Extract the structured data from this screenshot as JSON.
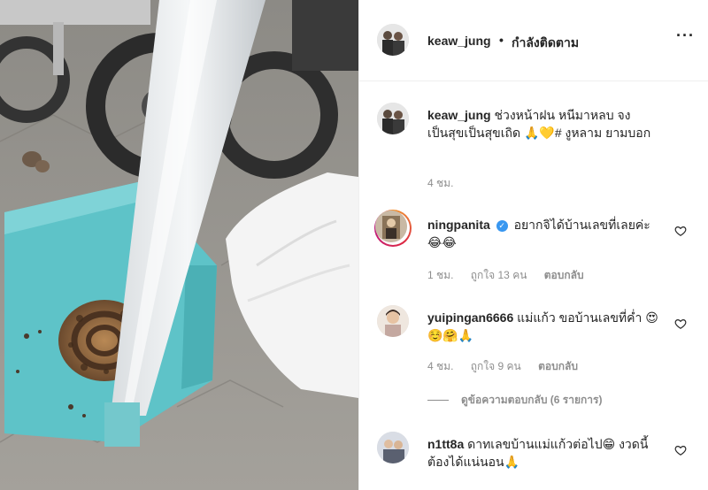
{
  "post": {
    "username": "keaw_jung",
    "separator": "•",
    "follow_status": "กำลังติดตาม",
    "more_label": "···",
    "caption": "ช่วงหน้าฝน หนีมาหลบ จงเป็นสุขเป็นสุขเถิด 🙏💛# งูหลาม ยามบอก",
    "time": "4 ชม."
  },
  "comments": [
    {
      "username": "ningpanita",
      "verified": true,
      "text": "อยากจิได้บ้านเลขที่เลยค่ะ 😂😂",
      "time": "1 ชม.",
      "likes": "ถูกใจ 13 คน",
      "reply": "ตอบกลับ"
    },
    {
      "username": "yuipingan6666",
      "verified": false,
      "text": "แม่แก้ว ขอบ้านเลขที่ค่ำ 😍☺️🤗🙏",
      "time": "4 ชม.",
      "likes": "ถูกใจ 9 คน",
      "reply": "ตอบกลับ"
    },
    {
      "username": "n1tt8a",
      "verified": false,
      "text": "ดาทเลขบ้านแม่แก้วต่อไป😁 งวดนี้ต้องได้แน่นอน🙏"
    }
  ],
  "view_replies": "ดูข้อความตอบกลับ (6 รายการ)",
  "colors": {
    "link": "#3897f0",
    "muted": "#8e8e8e",
    "text": "#262626"
  },
  "icons": [
    "more-options-icon",
    "verified-badge-icon",
    "heart-icon"
  ]
}
